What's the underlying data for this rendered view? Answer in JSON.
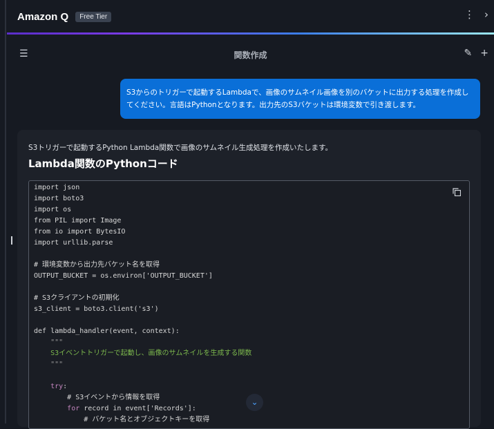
{
  "header": {
    "title": "Amazon Q",
    "badge": "Free Tier",
    "more_icon": "⋮",
    "collapse_icon": "›"
  },
  "conversation": {
    "menu_icon": "☰",
    "title": "関数作成",
    "edit_icon": "✎",
    "new_icon": "+"
  },
  "user_message": "S3からのトリガーで起動するLambdaで、画像のサムネイル画像を別のバケットに出力する処理を作成してください。言語はPythonとなります。出力先のS3バケットは環境変数で引き渡します。",
  "response": {
    "intro": "S3トリガーで起動するPython Lambda関数で画像のサムネイル生成処理を作成いたします。",
    "heading": "Lambda関数のPythonコード",
    "code_lines": [
      [
        {
          "t": "import json",
          "c": ""
        }
      ],
      [
        {
          "t": "import boto3",
          "c": ""
        }
      ],
      [
        {
          "t": "import os",
          "c": ""
        }
      ],
      [
        {
          "t": "from PIL import Image",
          "c": ""
        }
      ],
      [
        {
          "t": "from io import BytesIO",
          "c": ""
        }
      ],
      [
        {
          "t": "import urllib.parse",
          "c": ""
        }
      ],
      [],
      [
        {
          "t": "# 環境変数から出力先バケット名を取得",
          "c": ""
        }
      ],
      [
        {
          "t": "OUTPUT_BUCKET = os.environ['OUTPUT_BUCKET']",
          "c": ""
        }
      ],
      [],
      [
        {
          "t": "# S3クライアントの初期化",
          "c": ""
        }
      ],
      [
        {
          "t": "s3_client = boto3.client('s3')",
          "c": ""
        }
      ],
      [],
      [
        {
          "t": "def lambda_handler(event, context):",
          "c": ""
        }
      ],
      [
        {
          "t": "    ",
          "c": ""
        },
        {
          "t": "\"\"\"",
          "c": "q"
        }
      ],
      [
        {
          "t": "    S3イベントトリガーで起動し、画像のサムネイルを生成する関数",
          "c": "d"
        }
      ],
      [
        {
          "t": "    ",
          "c": ""
        },
        {
          "t": "\"\"\"",
          "c": "q"
        }
      ],
      [],
      [
        {
          "t": "    ",
          "c": ""
        },
        {
          "t": "try",
          "c": "k"
        },
        {
          "t": ":",
          "c": ""
        }
      ],
      [
        {
          "t": "        # S3イベントから情報を取得",
          "c": ""
        }
      ],
      [
        {
          "t": "        ",
          "c": ""
        },
        {
          "t": "for",
          "c": "k"
        },
        {
          "t": " record in event['Records']:",
          "c": ""
        }
      ],
      [
        {
          "t": "            # バケット名とオブジェクトキーを取得",
          "c": ""
        }
      ]
    ]
  },
  "scroll_down_icon": "⌄"
}
